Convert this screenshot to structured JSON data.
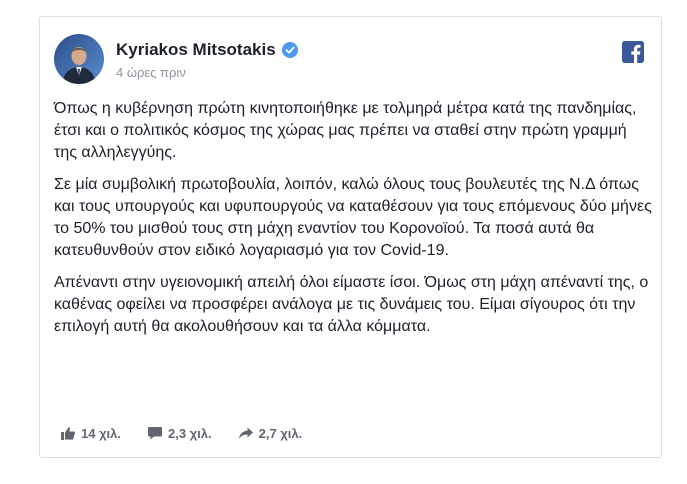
{
  "post": {
    "author": "Kyriakos Mitsotakis",
    "timestamp": "4 ώρες πριν",
    "paragraphs": [
      "Όπως η κυβέρνηση πρώτη κινητοποιήθηκε με τολμηρά μέτρα κατά της πανδημίας, έτσι και ο πολιτικός κόσμος της χώρας μας πρέπει να σταθεί στην πρώτη γραμμή της αλληλεγγύης.",
      "Σε μία συμβολική πρωτοβουλία, λοιπόν, καλώ όλους τους βουλευτές της Ν.Δ όπως και τους υπουργούς και υφυπουργούς να καταθέσουν για τους επόμενους δύο μήνες το 50% του μισθού τους στη μάχη εναντίον του Κορονοϊού. Τα ποσά αυτά θα κατευθυνθούν στον ειδικό λογαριασμό για τον Covid-19.",
      "Απέναντι στην υγειονομική απειλή όλοι είμαστε ίσοι. Όμως στη μάχη απέναντί της, ο καθένας οφείλει να προσφέρει ανάλογα με τις δυνάμεις του. Είμαι σίγουρος ότι την επιλογή αυτή θα ακολουθήσουν και τα άλλα κόμματα."
    ]
  },
  "stats": {
    "likes": "14 χιλ.",
    "comments": "2,3 χιλ.",
    "shares": "2,7 χιλ."
  },
  "icons": {
    "verified": "verified-badge-icon",
    "facebook": "facebook-logo-icon",
    "like": "thumbs-up-icon",
    "comment": "comment-bubble-icon",
    "share": "share-arrow-icon"
  },
  "colors": {
    "facebook_blue": "#3b5998",
    "verified_blue": "#4c9bf0",
    "footer_gray": "#606770"
  }
}
